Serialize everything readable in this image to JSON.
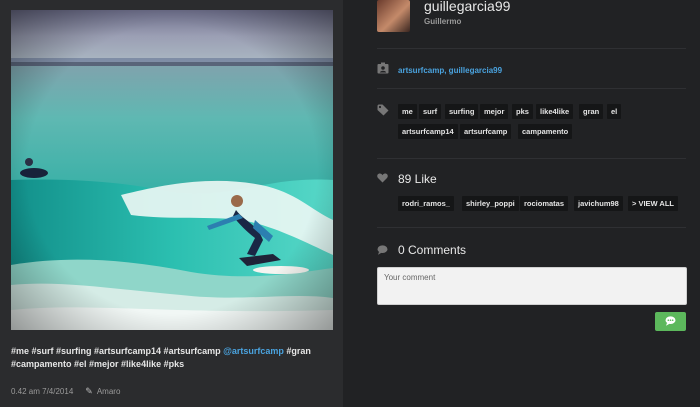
{
  "post": {
    "caption_parts": [
      {
        "text": "#me #surf #surfing #artsurfcamp14 #artsurfcamp ",
        "kind": "tag"
      },
      {
        "text": "@artsurfcamp",
        "kind": "mention"
      },
      {
        "text": " #gran #campamento #el #mejor #like4like #pks",
        "kind": "tag"
      }
    ],
    "time": "0.42 am 7/4/2014",
    "filter": "Amaro"
  },
  "user": {
    "username": "guillegarcia99",
    "full_name": "Guillermo"
  },
  "tagged_users": "artsurfcamp, guillegarcia99",
  "tags": [
    "me",
    "surf",
    "surfing",
    "mejor",
    "pks",
    "like4like",
    "gran",
    "el",
    "artsurfcamp14",
    "artsurfcamp",
    "campamento"
  ],
  "likes": {
    "label": "89 Like",
    "users": [
      "rodri_ramos_",
      "shirley_poppi",
      "rociomatas",
      "javichum98"
    ],
    "view_all": "> VIEW ALL"
  },
  "comments": {
    "label": "0 Comments",
    "placeholder": "Your comment"
  },
  "icons": {
    "tagged": "person-badge-icon",
    "tags": "tag-icon",
    "likes": "heart-icon",
    "comments": "speech-bubble-icon",
    "send": "chat-send-icon",
    "filter": "pencil-icon"
  },
  "colors": {
    "link": "#4aa3df",
    "send_button": "#5cb85c"
  }
}
